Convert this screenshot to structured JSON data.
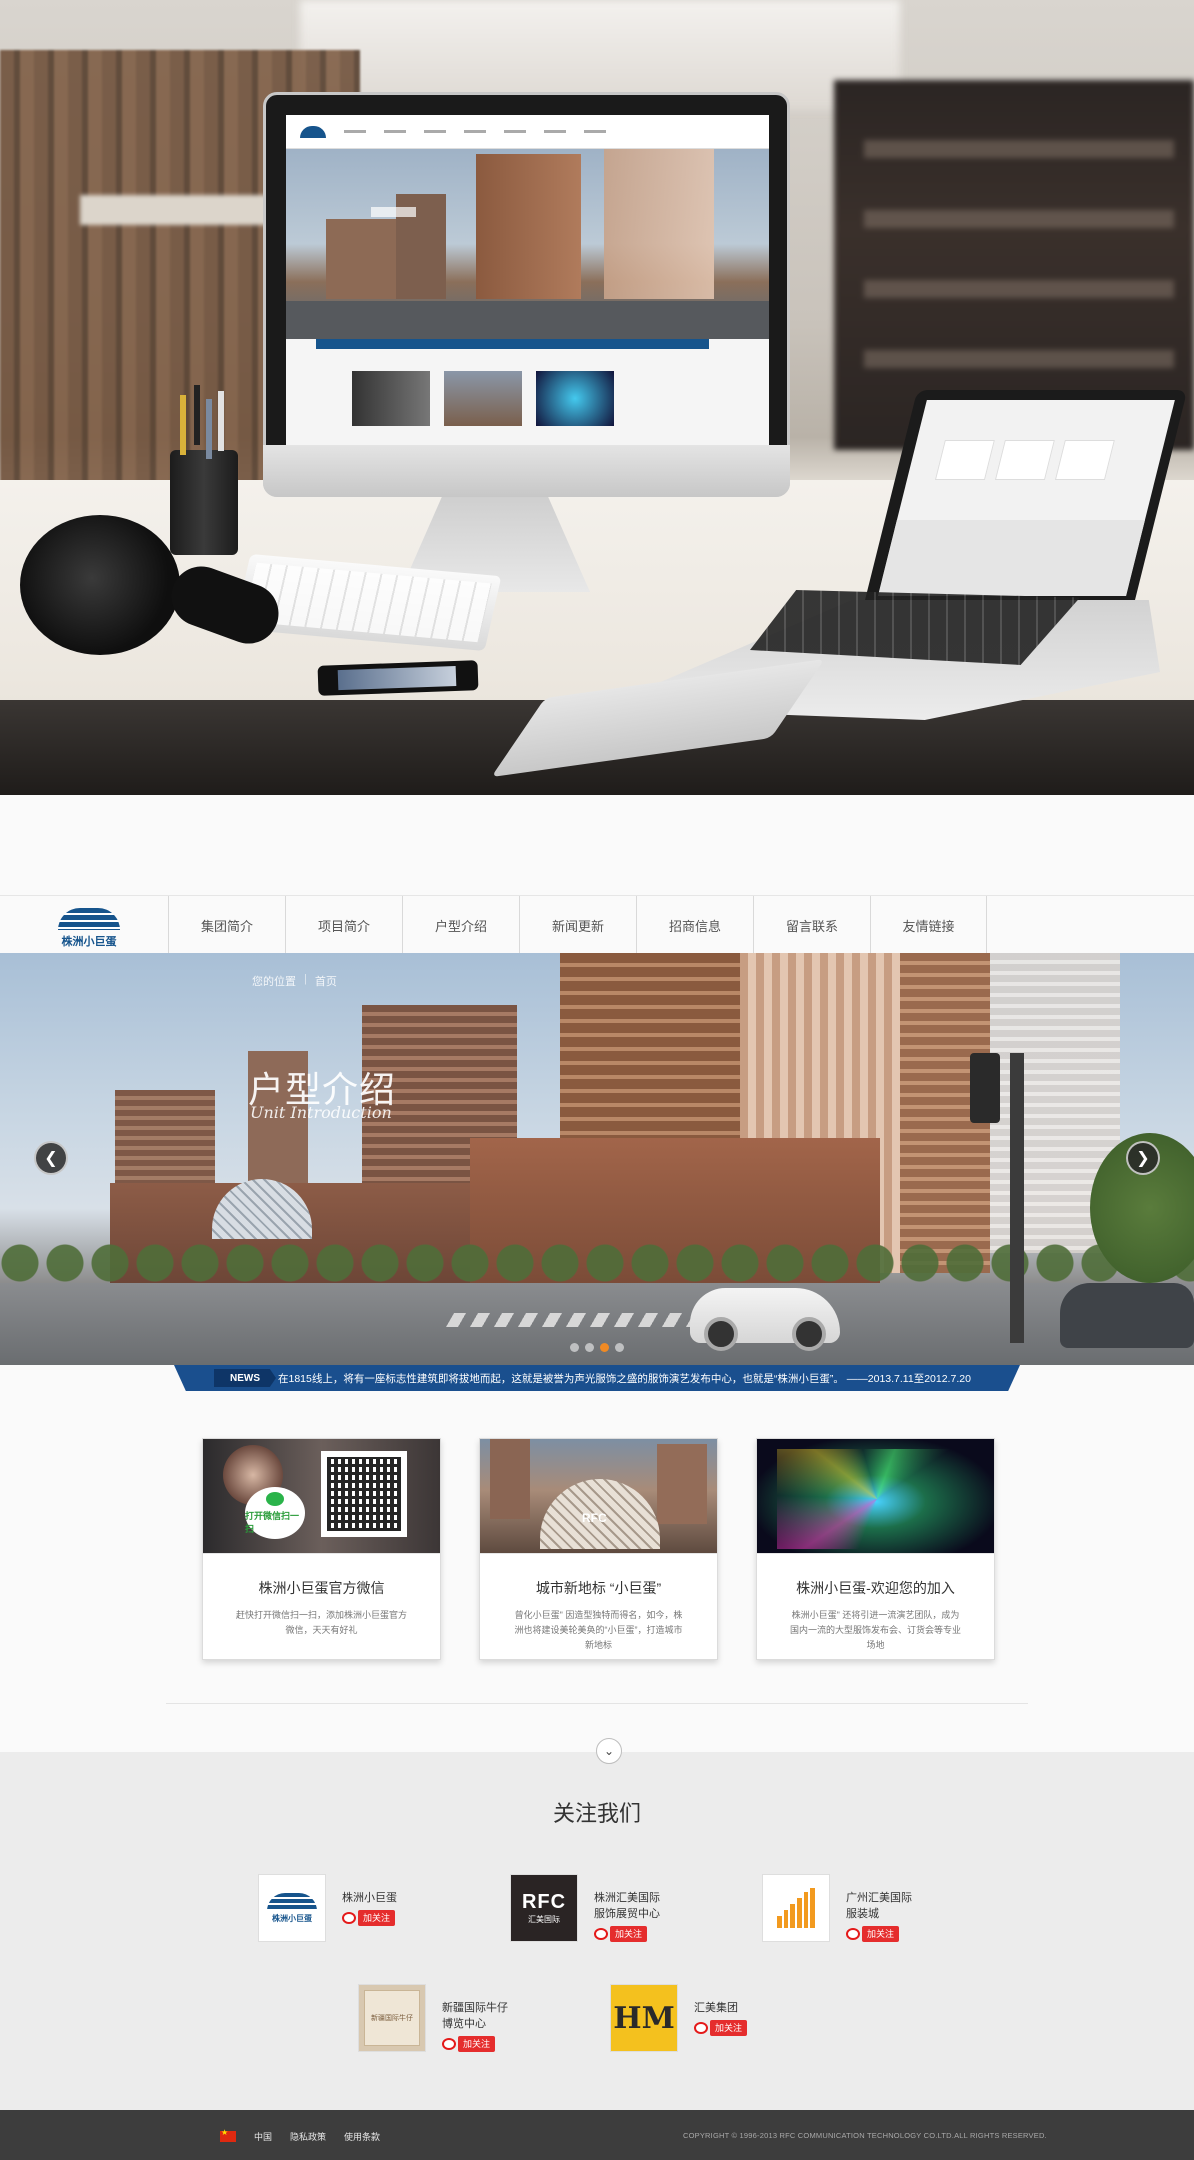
{
  "hero": {
    "mockup_devices": [
      "imac",
      "macbook",
      "keyboard",
      "headphones",
      "pen-holder",
      "phone",
      "trackpad"
    ]
  },
  "site": {
    "logo_name": "株洲小巨蛋",
    "nav": [
      "集团简介",
      "项目简介",
      "户型介绍",
      "新闻更新",
      "招商信息",
      "留言联系",
      "友情链接"
    ]
  },
  "banner": {
    "breadcrumb": [
      "您的位置",
      "首页"
    ],
    "title": "户型介绍",
    "subtitle": "Unit Introduction",
    "prev_icon": "chevron-left-icon",
    "next_icon": "chevron-right-icon",
    "dots_total": 4,
    "active_dot": 3
  },
  "news": {
    "tag": "NEWS",
    "text": "在1815线上，将有一座标志性建筑即将拔地而起，这就是被誉为声光服饰之盛的服饰演艺发布中心，也就是“株洲小巨蛋”。 ——2013.7.11至2012.7.20"
  },
  "cards": [
    {
      "title": "株洲小巨蛋官方微信",
      "desc": "赶快打开微信扫一扫，添加株洲小巨蛋官方微信，天天有好礼",
      "badge": "打开微信扫一扫"
    },
    {
      "title": "城市新地标 “小巨蛋”",
      "desc": "曾化小巨蛋\" 因造型独特而得名，如今，株洲也将建设美轮美奂的“小巨蛋”，打造城市新地标",
      "mark": "RFC"
    },
    {
      "title": "株洲小巨蛋-欢迎您的加入",
      "desc": "株洲小巨蛋\" 还将引进一流演艺团队，成为国内一流的大型服饰发布会、订货会等专业场地"
    }
  ],
  "follow": {
    "title": "关注我们",
    "button_label": "加关注",
    "brands": [
      {
        "name": "株洲小巨蛋",
        "logo": "xjd"
      },
      {
        "name": "株洲汇美国际\n服饰展贸中心",
        "logo": "rfc",
        "logo_text": "RFC",
        "logo_sub": "汇美国际"
      },
      {
        "name": "广州汇美国际\n服装城",
        "logo": "gz"
      },
      {
        "name": "新疆国际牛仔\n博览中心",
        "logo": "xj",
        "logo_text": "新疆国际牛仔"
      },
      {
        "name": "汇美集团",
        "logo": "hm",
        "logo_text": "HM"
      }
    ]
  },
  "footer": {
    "links": [
      "中国",
      "隐私政策",
      "使用条款"
    ],
    "copyright": "COPYRIGHT © 1996-2013 RFC COMMUNICATION TECHNOLOGY CO.LTD.ALL RIGHTS RESERVED."
  },
  "colors": {
    "brand_blue": "#1a4f8e",
    "weibo_red": "#e52d2d",
    "dot_active": "#f08a24",
    "footer_bg": "#3d3d3d"
  }
}
